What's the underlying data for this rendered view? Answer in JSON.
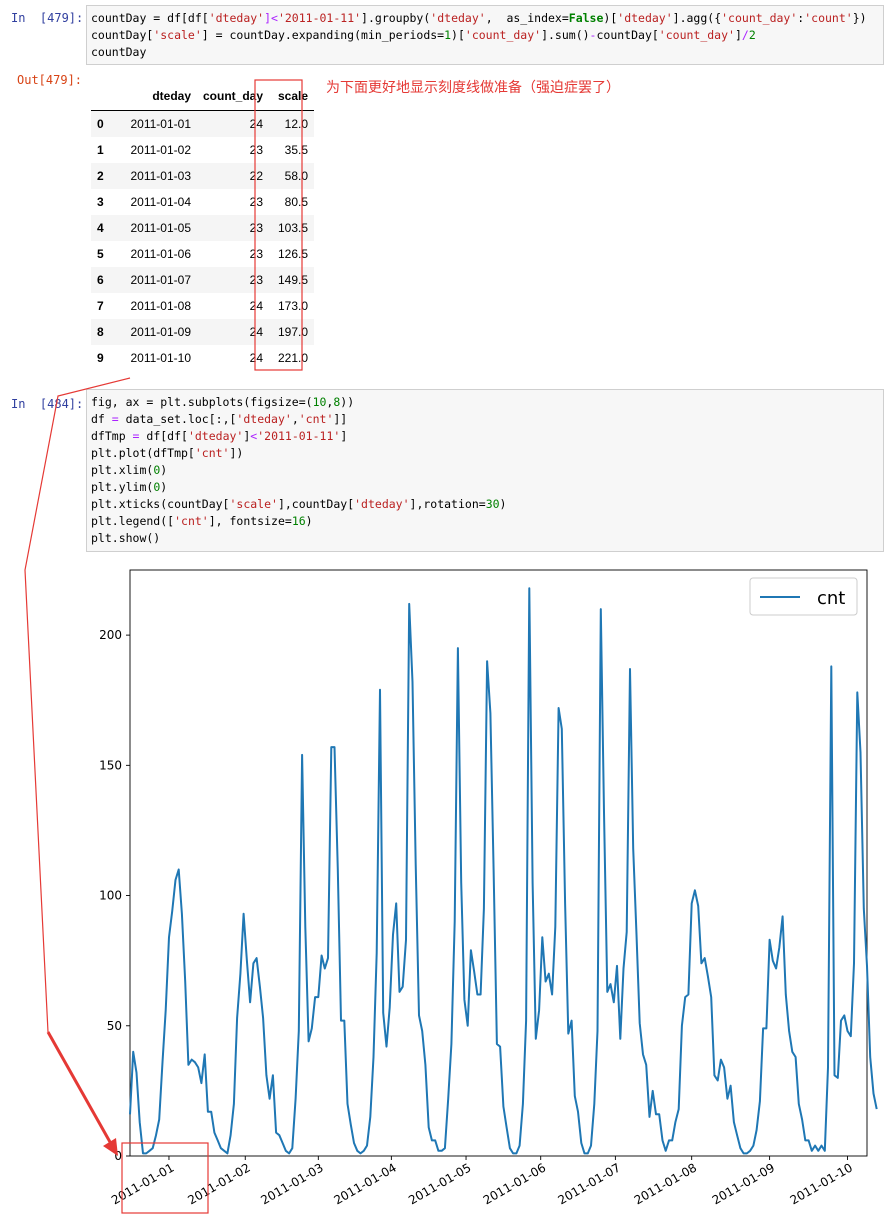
{
  "cell1": {
    "prompt": "In  [479]:",
    "code": [
      [
        [
          "countDay = df[df[",
          ""
        ],
        [
          "'dteday'",
          "s"
        ],
        [
          "]<",
          "o"
        ],
        [
          "'2011-01-11'",
          "s"
        ],
        [
          "].groupby(",
          ""
        ],
        [
          "'dteday'",
          "s"
        ],
        [
          ",  as_index=",
          ""
        ],
        [
          "False",
          "k"
        ],
        [
          ")[",
          ""
        ],
        [
          "'dteday'",
          "s"
        ],
        [
          "].agg({",
          ""
        ],
        [
          "'count_day'",
          "s"
        ],
        [
          ":",
          ""
        ],
        [
          "'count'",
          "s"
        ],
        [
          "})",
          ""
        ]
      ],
      [
        [
          "countDay[",
          ""
        ],
        [
          "'scale'",
          "s"
        ],
        [
          "] = countDay.expanding(min_periods=",
          ""
        ],
        [
          "1",
          "n"
        ],
        [
          ")[",
          ""
        ],
        [
          "'count_day'",
          "s"
        ],
        [
          "].sum()",
          ""
        ],
        [
          "-",
          "o"
        ],
        [
          "countDay[",
          ""
        ],
        [
          "'count_day'",
          "s"
        ],
        [
          "]",
          ""
        ],
        [
          "/",
          "o"
        ],
        [
          "2",
          "n"
        ]
      ],
      [
        [
          "countDay",
          ""
        ]
      ]
    ]
  },
  "output1": {
    "prompt": "Out[479]:",
    "columns": [
      "",
      "dteday",
      "count_day",
      "scale"
    ],
    "rows": [
      [
        "0",
        "2011-01-01",
        "24",
        "12.0"
      ],
      [
        "1",
        "2011-01-02",
        "23",
        "35.5"
      ],
      [
        "2",
        "2011-01-03",
        "22",
        "58.0"
      ],
      [
        "3",
        "2011-01-04",
        "23",
        "80.5"
      ],
      [
        "4",
        "2011-01-05",
        "23",
        "103.5"
      ],
      [
        "5",
        "2011-01-06",
        "23",
        "126.5"
      ],
      [
        "6",
        "2011-01-07",
        "23",
        "149.5"
      ],
      [
        "7",
        "2011-01-08",
        "24",
        "173.0"
      ],
      [
        "8",
        "2011-01-09",
        "24",
        "197.0"
      ],
      [
        "9",
        "2011-01-10",
        "24",
        "221.0"
      ]
    ],
    "annotation": "为下面更好地显示刻度线做准备（强迫症罢了）"
  },
  "cell2": {
    "prompt": "In  [484]:",
    "code": [
      [
        [
          "fig, ax = plt.subplots(figsize=(",
          ""
        ],
        [
          "10",
          "n"
        ],
        [
          ",",
          ""
        ],
        [
          "8",
          "n"
        ],
        [
          "))",
          ""
        ]
      ],
      [
        [
          "df ",
          ""
        ],
        [
          "=",
          "o"
        ],
        [
          " data_set.loc[:,[",
          ""
        ],
        [
          "'dteday'",
          "s"
        ],
        [
          ",",
          ""
        ],
        [
          "'cnt'",
          "s"
        ],
        [
          "]]",
          ""
        ]
      ],
      [
        [
          "dfTmp ",
          ""
        ],
        [
          "=",
          "o"
        ],
        [
          " df[df[",
          ""
        ],
        [
          "'dteday'",
          "s"
        ],
        [
          "]",
          ""
        ],
        [
          "<",
          "o"
        ],
        [
          "'2011-01-11'",
          "s"
        ],
        [
          "]",
          ""
        ]
      ],
      [
        [
          "plt.plot(dfTmp[",
          ""
        ],
        [
          "'cnt'",
          "s"
        ],
        [
          "])",
          ""
        ]
      ],
      [
        [
          "plt.xlim(",
          ""
        ],
        [
          "0",
          "n"
        ],
        [
          ")",
          ""
        ]
      ],
      [
        [
          "plt.ylim(",
          ""
        ],
        [
          "0",
          "n"
        ],
        [
          ")",
          ""
        ]
      ],
      [
        [
          "plt.xticks(countDay[",
          ""
        ],
        [
          "'scale'",
          "s"
        ],
        [
          "],countDay[",
          ""
        ],
        [
          "'dteday'",
          "s"
        ],
        [
          "],rotation=",
          ""
        ],
        [
          "30",
          "n"
        ],
        [
          ")",
          ""
        ]
      ],
      [
        [
          "plt.legend([",
          ""
        ],
        [
          "'cnt'",
          "s"
        ],
        [
          "], fontsize=",
          ""
        ],
        [
          "16",
          "n"
        ],
        [
          ")",
          ""
        ]
      ],
      [
        [
          "plt.show()",
          ""
        ]
      ]
    ]
  },
  "chart_data": {
    "type": "line",
    "xlim": [
      0,
      227
    ],
    "ylim": [
      0,
      225
    ],
    "yticks": [
      0,
      50,
      100,
      150,
      200
    ],
    "xticks": [
      12.0,
      35.5,
      58.0,
      80.5,
      103.5,
      126.5,
      149.5,
      173.0,
      197.0,
      221.0
    ],
    "xticklabels": [
      "2011-01-01",
      "2011-01-02",
      "2011-01-03",
      "2011-01-04",
      "2011-01-05",
      "2011-01-06",
      "2011-01-07",
      "2011-01-08",
      "2011-01-09",
      "2011-01-10"
    ],
    "legend": [
      "cnt"
    ],
    "legend_position": "upper-right",
    "color": "#1f77b4",
    "series": [
      {
        "name": "cnt",
        "values": [
          16,
          40,
          32,
          13,
          1,
          1,
          2,
          3,
          8,
          14,
          36,
          56,
          84,
          94,
          106,
          110,
          93,
          67,
          35,
          37,
          36,
          34,
          28,
          39,
          17,
          17,
          9,
          6,
          3,
          2,
          1,
          8,
          20,
          53,
          70,
          93,
          75,
          59,
          74,
          76,
          65,
          53,
          31,
          22,
          31,
          9,
          8,
          5,
          2,
          1,
          3,
          22,
          48,
          154,
          88,
          44,
          49,
          61,
          61,
          77,
          72,
          76,
          157,
          157,
          110,
          52,
          52,
          20,
          12,
          5,
          2,
          1,
          2,
          4,
          15,
          38,
          78,
          179,
          55,
          42,
          57,
          85,
          97,
          63,
          65,
          83,
          212,
          182,
          112,
          54,
          48,
          35,
          11,
          6,
          6,
          2,
          2,
          3,
          22,
          43,
          90,
          195,
          105,
          60,
          50,
          79,
          71,
          62,
          62,
          95,
          190,
          170,
          110,
          43,
          42,
          19,
          11,
          3,
          1,
          1,
          4,
          20,
          52,
          218,
          105,
          45,
          56,
          84,
          67,
          70,
          62,
          88,
          172,
          164,
          97,
          47,
          52,
          23,
          17,
          5,
          1,
          1,
          4,
          20,
          48,
          210,
          132,
          63,
          66,
          59,
          73,
          45,
          72,
          86,
          187,
          118,
          85,
          51,
          39,
          35,
          15,
          25,
          16,
          16,
          6,
          2,
          6,
          6,
          13,
          18,
          50,
          61,
          62,
          97,
          102,
          96,
          74,
          76,
          69,
          61,
          31,
          29,
          37,
          34,
          22,
          27,
          13,
          8,
          3,
          1,
          1,
          2,
          4,
          10,
          21,
          49,
          49,
          83,
          75,
          72,
          80,
          92,
          62,
          48,
          40,
          38,
          20,
          14,
          6,
          6,
          2,
          4,
          2,
          4,
          2,
          34,
          188,
          31,
          30,
          52,
          54,
          48,
          46,
          74,
          178,
          155,
          95,
          73,
          38,
          24,
          18
        ]
      }
    ]
  }
}
